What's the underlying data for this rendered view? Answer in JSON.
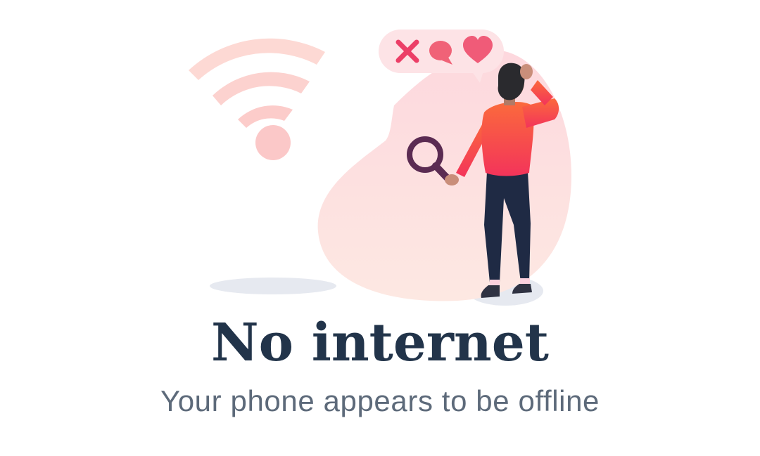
{
  "empty_state": {
    "title": "No internet",
    "subtitle": "Your phone appears to be offline"
  },
  "illustration": {
    "icons": [
      "wifi-icon",
      "close-icon",
      "chat-bubble-icon",
      "heart-icon",
      "magnifying-glass-icon"
    ],
    "colors": {
      "wifi": "#fcd5d3",
      "blob": "#fde1e1",
      "bubble": "#fde3e6",
      "accent": "#ec3f67",
      "shirt": "#f63f4f",
      "pants": "#1f2a44",
      "magnifier": "#5b2b52",
      "shadow": "#e3e7ef"
    }
  }
}
